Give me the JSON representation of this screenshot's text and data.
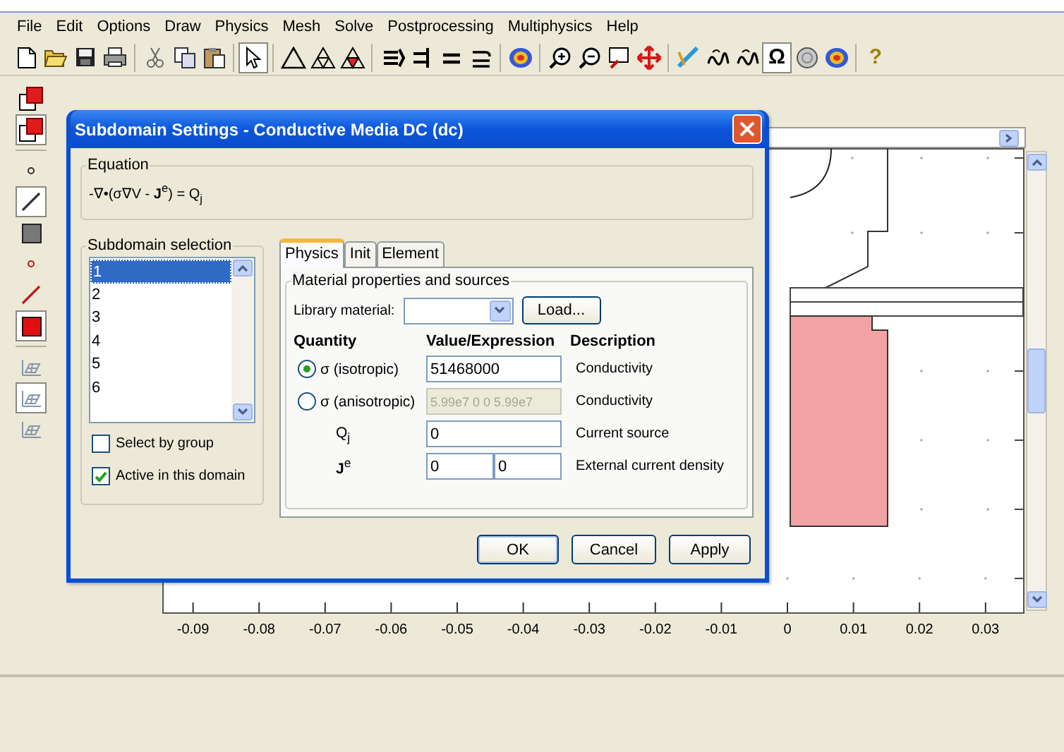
{
  "menu": [
    "File",
    "Edit",
    "Options",
    "Draw",
    "Physics",
    "Mesh",
    "Solve",
    "Postprocessing",
    "Multiphysics",
    "Help"
  ],
  "toolbar": [
    {
      "kind": "new",
      "pressed": false
    },
    {
      "kind": "open",
      "pressed": false
    },
    {
      "kind": "save",
      "pressed": false
    },
    {
      "kind": "print",
      "pressed": false
    },
    {
      "kind": "separator"
    },
    {
      "kind": "cut",
      "pressed": false
    },
    {
      "kind": "copy",
      "pressed": false
    },
    {
      "kind": "paste",
      "pressed": false
    },
    {
      "kind": "separator"
    },
    {
      "kind": "pointer",
      "pressed": true
    },
    {
      "kind": "separator"
    },
    {
      "kind": "triangle",
      "pressed": false
    },
    {
      "kind": "triangle-mesh",
      "pressed": false
    },
    {
      "kind": "triangle-red",
      "pressed": false
    },
    {
      "kind": "separator"
    },
    {
      "kind": "bars-arrow",
      "pressed": false
    },
    {
      "kind": "bars-arrow-right",
      "pressed": false
    },
    {
      "kind": "equals",
      "pressed": false
    },
    {
      "kind": "equals-arrow",
      "pressed": false
    },
    {
      "kind": "separator"
    },
    {
      "kind": "blob",
      "pressed": false
    },
    {
      "kind": "separator"
    },
    {
      "kind": "zoom-in",
      "pressed": false
    },
    {
      "kind": "zoom-out",
      "pressed": false
    },
    {
      "kind": "zoom-box",
      "pressed": false
    },
    {
      "kind": "move",
      "pressed": false
    },
    {
      "kind": "separator"
    },
    {
      "kind": "pencil",
      "pressed": false
    },
    {
      "kind": "squiggle",
      "pressed": false
    },
    {
      "kind": "squiggle",
      "pressed": false
    },
    {
      "kind": "glyph",
      "text": "Ω",
      "pressed": true
    },
    {
      "kind": "sphere",
      "pressed": false
    },
    {
      "kind": "blob",
      "pressed": false
    },
    {
      "kind": "separator"
    },
    {
      "kind": "glyph",
      "text": "?",
      "pressed": false
    }
  ],
  "side_toolbar": [
    {
      "kind": "squares-red",
      "pressed": false
    },
    {
      "kind": "squares-red",
      "pressed": true
    },
    {
      "kind": "separator"
    },
    {
      "kind": "point",
      "pressed": false
    },
    {
      "kind": "line",
      "pressed": true
    },
    {
      "kind": "square-grey",
      "pressed": false
    },
    {
      "kind": "point-red",
      "pressed": false
    },
    {
      "kind": "line-red",
      "pressed": false
    },
    {
      "kind": "square-red",
      "pressed": true
    },
    {
      "kind": "separator"
    },
    {
      "kind": "mesh",
      "pressed": false
    },
    {
      "kind": "mesh",
      "pressed": true
    },
    {
      "kind": "mesh",
      "pressed": false
    }
  ],
  "plot": {
    "x_ticks": [
      "-0.09",
      "-0.08",
      "-0.07",
      "-0.06",
      "-0.05",
      "-0.04",
      "-0.03",
      "-0.02",
      "-0.01",
      "0",
      "0.01",
      "0.02",
      "0.03"
    ]
  },
  "dialog": {
    "title": "Subdomain Settings - Conductive Media DC (dc)",
    "equation": {
      "label": "Equation",
      "formula": "-∇•(σ∇V - **J**$^{e}$) = Q$_{j}$"
    },
    "subdomains": {
      "label": "Subdomain selection",
      "items": [
        {
          "label": "1",
          "selected": true
        },
        {
          "label": "2",
          "selected": false
        },
        {
          "label": "3",
          "selected": false
        },
        {
          "label": "4",
          "selected": false
        },
        {
          "label": "5",
          "selected": false
        },
        {
          "label": "6",
          "selected": false
        }
      ],
      "options": [
        {
          "label": "Select by group",
          "checked": false
        },
        {
          "label": "Active in this domain",
          "checked": true
        }
      ]
    },
    "tabs": [
      {
        "label": "Physics",
        "selected": true
      },
      {
        "label": "Init",
        "selected": false
      },
      {
        "label": "Element",
        "selected": false
      }
    ],
    "material": {
      "label": "Material properties and sources",
      "library_label": "Library material:",
      "load_button": "Load...",
      "columns": [
        "Quantity",
        "Value/Expression",
        "Description"
      ],
      "rows": [
        {
          "kind": "radio",
          "quantity": "σ (isotropic)",
          "selected": true,
          "values": [
            "51468000"
          ],
          "disabled": false,
          "description": "Conductivity"
        },
        {
          "kind": "radio",
          "quantity": "σ (anisotropic)",
          "selected": false,
          "values": [
            "5.99e7 0 0 5.99e7"
          ],
          "disabled": true,
          "description": "Conductivity"
        },
        {
          "kind": "symbol",
          "quantity": "Q$_{j}$",
          "values": [
            "0"
          ],
          "disabled": false,
          "description": "Current source"
        },
        {
          "kind": "symbol",
          "quantity": "**J**$^{e}$",
          "values": [
            "0",
            "0"
          ],
          "disabled": false,
          "description": "External current density"
        }
      ]
    },
    "buttons": [
      "OK",
      "Cancel",
      "Apply"
    ]
  }
}
